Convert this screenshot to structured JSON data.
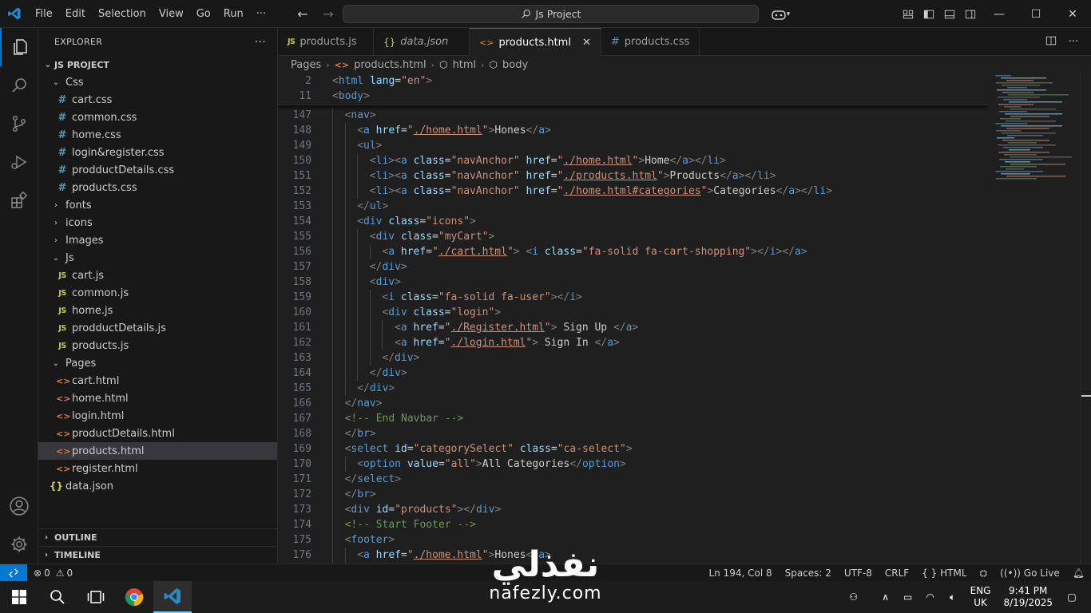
{
  "menu": [
    "File",
    "Edit",
    "Selection",
    "View",
    "Go",
    "Run",
    "···"
  ],
  "command_center": "Js Project",
  "explorer": {
    "title": "EXPLORER",
    "more": "···",
    "project": "JS PROJECT",
    "tree": [
      {
        "label": "Css",
        "kind": "folder-open",
        "depth": 1
      },
      {
        "label": "cart.css",
        "kind": "css",
        "depth": 2
      },
      {
        "label": "common.css",
        "kind": "css",
        "depth": 2
      },
      {
        "label": "home.css",
        "kind": "css",
        "depth": 2
      },
      {
        "label": "login&register.css",
        "kind": "css",
        "depth": 2
      },
      {
        "label": "prodductDetails.css",
        "kind": "css",
        "depth": 2
      },
      {
        "label": "products.css",
        "kind": "css",
        "depth": 2
      },
      {
        "label": "fonts",
        "kind": "folder",
        "depth": 1
      },
      {
        "label": "icons",
        "kind": "folder",
        "depth": 1
      },
      {
        "label": "Images",
        "kind": "folder",
        "depth": 1
      },
      {
        "label": "Js",
        "kind": "folder-open",
        "depth": 1
      },
      {
        "label": "cart.js",
        "kind": "js",
        "depth": 2
      },
      {
        "label": "common.js",
        "kind": "js",
        "depth": 2
      },
      {
        "label": "home.js",
        "kind": "js",
        "depth": 2
      },
      {
        "label": "prodductDetails.js",
        "kind": "js",
        "depth": 2
      },
      {
        "label": "products.js",
        "kind": "js",
        "depth": 2
      },
      {
        "label": "Pages",
        "kind": "folder-open",
        "depth": 1
      },
      {
        "label": "cart.html",
        "kind": "html",
        "depth": 2
      },
      {
        "label": "home.html",
        "kind": "html",
        "depth": 2
      },
      {
        "label": "login.html",
        "kind": "html",
        "depth": 2
      },
      {
        "label": "productDetails.html",
        "kind": "html",
        "depth": 2
      },
      {
        "label": "products.html",
        "kind": "html",
        "depth": 2,
        "selected": true
      },
      {
        "label": "register.html",
        "kind": "html",
        "depth": 2
      },
      {
        "label": "data.json",
        "kind": "json",
        "depth": 1
      }
    ],
    "outline": "OUTLINE",
    "timeline": "TIMELINE"
  },
  "tabs": [
    {
      "label": "products.js",
      "kind": "js"
    },
    {
      "label": "data.json",
      "kind": "json"
    },
    {
      "label": "products.html",
      "kind": "html",
      "active": true
    },
    {
      "label": "products.css",
      "kind": "css"
    }
  ],
  "breadcrumb": [
    "Pages",
    "products.html",
    "html",
    "body"
  ],
  "sticky_lines": [
    {
      "n": "2",
      "indent": 0,
      "tokens": [
        [
          "b",
          "<"
        ],
        [
          "t",
          "html"
        ],
        [
          "x",
          " "
        ],
        [
          "a",
          "lang"
        ],
        [
          "x",
          "="
        ],
        [
          "s",
          "\"en\""
        ],
        [
          "b",
          ">"
        ]
      ]
    },
    {
      "n": "11",
      "indent": 0,
      "tokens": [
        [
          "b",
          "<"
        ],
        [
          "t",
          "body"
        ],
        [
          "b",
          ">"
        ]
      ]
    }
  ],
  "code_lines": [
    {
      "n": "147",
      "indent": 1,
      "tokens": [
        [
          "b",
          "<"
        ],
        [
          "t",
          "nav"
        ],
        [
          "b",
          ">"
        ]
      ]
    },
    {
      "n": "148",
      "indent": 2,
      "tokens": [
        [
          "b",
          "<"
        ],
        [
          "t",
          "a"
        ],
        [
          "x",
          " "
        ],
        [
          "a",
          "href"
        ],
        [
          "x",
          "="
        ],
        [
          "s",
          "\""
        ],
        [
          "u",
          "./home.html"
        ],
        [
          "s",
          "\""
        ],
        [
          "b",
          ">"
        ],
        [
          "x",
          "Hones"
        ],
        [
          "b",
          "</"
        ],
        [
          "t",
          "a"
        ],
        [
          "b",
          ">"
        ]
      ]
    },
    {
      "n": "149",
      "indent": 2,
      "tokens": [
        [
          "b",
          "<"
        ],
        [
          "t",
          "ul"
        ],
        [
          "b",
          ">"
        ]
      ]
    },
    {
      "n": "150",
      "indent": 3,
      "tokens": [
        [
          "b",
          "<"
        ],
        [
          "t",
          "li"
        ],
        [
          "b",
          "><"
        ],
        [
          "t",
          "a"
        ],
        [
          "x",
          " "
        ],
        [
          "a",
          "class"
        ],
        [
          "x",
          "="
        ],
        [
          "s",
          "\"navAnchor\""
        ],
        [
          "x",
          " "
        ],
        [
          "a",
          "href"
        ],
        [
          "x",
          "="
        ],
        [
          "s",
          "\""
        ],
        [
          "u",
          "./home.html"
        ],
        [
          "s",
          "\""
        ],
        [
          "b",
          ">"
        ],
        [
          "x",
          "Home"
        ],
        [
          "b",
          "</"
        ],
        [
          "t",
          "a"
        ],
        [
          "b",
          "></"
        ],
        [
          "t",
          "li"
        ],
        [
          "b",
          ">"
        ]
      ]
    },
    {
      "n": "151",
      "indent": 3,
      "tokens": [
        [
          "b",
          "<"
        ],
        [
          "t",
          "li"
        ],
        [
          "b",
          "><"
        ],
        [
          "t",
          "a"
        ],
        [
          "x",
          " "
        ],
        [
          "a",
          "class"
        ],
        [
          "x",
          "="
        ],
        [
          "s",
          "\"navAnchor\""
        ],
        [
          "x",
          " "
        ],
        [
          "a",
          "href"
        ],
        [
          "x",
          "="
        ],
        [
          "s",
          "\""
        ],
        [
          "u",
          "./products.html"
        ],
        [
          "s",
          "\""
        ],
        [
          "b",
          ">"
        ],
        [
          "x",
          "Products"
        ],
        [
          "b",
          "</"
        ],
        [
          "t",
          "a"
        ],
        [
          "b",
          "></"
        ],
        [
          "t",
          "li"
        ],
        [
          "b",
          ">"
        ]
      ]
    },
    {
      "n": "152",
      "indent": 3,
      "tokens": [
        [
          "b",
          "<"
        ],
        [
          "t",
          "li"
        ],
        [
          "b",
          "><"
        ],
        [
          "t",
          "a"
        ],
        [
          "x",
          " "
        ],
        [
          "a",
          "class"
        ],
        [
          "x",
          "="
        ],
        [
          "s",
          "\"navAnchor\""
        ],
        [
          "x",
          " "
        ],
        [
          "a",
          "href"
        ],
        [
          "x",
          "="
        ],
        [
          "s",
          "\""
        ],
        [
          "u",
          "./home.html#categories"
        ],
        [
          "s",
          "\""
        ],
        [
          "b",
          ">"
        ],
        [
          "x",
          "Categories"
        ],
        [
          "b",
          "</"
        ],
        [
          "t",
          "a"
        ],
        [
          "b",
          "></"
        ],
        [
          "t",
          "li"
        ],
        [
          "b",
          ">"
        ]
      ]
    },
    {
      "n": "153",
      "indent": 2,
      "tokens": [
        [
          "b",
          "</"
        ],
        [
          "t",
          "ul"
        ],
        [
          "b",
          ">"
        ]
      ]
    },
    {
      "n": "154",
      "indent": 2,
      "tokens": [
        [
          "b",
          "<"
        ],
        [
          "t",
          "div"
        ],
        [
          "x",
          " "
        ],
        [
          "a",
          "class"
        ],
        [
          "x",
          "="
        ],
        [
          "s",
          "\"icons\""
        ],
        [
          "b",
          ">"
        ]
      ]
    },
    {
      "n": "155",
      "indent": 3,
      "tokens": [
        [
          "b",
          "<"
        ],
        [
          "t",
          "div"
        ],
        [
          "x",
          " "
        ],
        [
          "a",
          "class"
        ],
        [
          "x",
          "="
        ],
        [
          "s",
          "\"myCart\""
        ],
        [
          "b",
          ">"
        ]
      ]
    },
    {
      "n": "156",
      "indent": 4,
      "tokens": [
        [
          "b",
          "<"
        ],
        [
          "t",
          "a"
        ],
        [
          "x",
          " "
        ],
        [
          "a",
          "href"
        ],
        [
          "x",
          "="
        ],
        [
          "s",
          "\""
        ],
        [
          "u",
          "./cart.html"
        ],
        [
          "s",
          "\""
        ],
        [
          "b",
          ">"
        ],
        [
          "x",
          " "
        ],
        [
          "b",
          "<"
        ],
        [
          "t",
          "i"
        ],
        [
          "x",
          " "
        ],
        [
          "a",
          "class"
        ],
        [
          "x",
          "="
        ],
        [
          "s",
          "\"fa-solid fa-cart-shopping\""
        ],
        [
          "b",
          "></"
        ],
        [
          "t",
          "i"
        ],
        [
          "b",
          "></"
        ],
        [
          "t",
          "a"
        ],
        [
          "b",
          ">"
        ]
      ]
    },
    {
      "n": "157",
      "indent": 3,
      "tokens": [
        [
          "b",
          "</"
        ],
        [
          "t",
          "div"
        ],
        [
          "b",
          ">"
        ]
      ]
    },
    {
      "n": "158",
      "indent": 3,
      "tokens": [
        [
          "b",
          "<"
        ],
        [
          "t",
          "div"
        ],
        [
          "b",
          ">"
        ]
      ]
    },
    {
      "n": "159",
      "indent": 4,
      "tokens": [
        [
          "b",
          "<"
        ],
        [
          "t",
          "i"
        ],
        [
          "x",
          " "
        ],
        [
          "a",
          "class"
        ],
        [
          "x",
          "="
        ],
        [
          "s",
          "\"fa-solid fa-user\""
        ],
        [
          "b",
          "></"
        ],
        [
          "t",
          "i"
        ],
        [
          "b",
          ">"
        ]
      ]
    },
    {
      "n": "160",
      "indent": 4,
      "tokens": [
        [
          "b",
          "<"
        ],
        [
          "t",
          "div"
        ],
        [
          "x",
          " "
        ],
        [
          "a",
          "class"
        ],
        [
          "x",
          "="
        ],
        [
          "s",
          "\"login\""
        ],
        [
          "b",
          ">"
        ]
      ]
    },
    {
      "n": "161",
      "indent": 5,
      "tokens": [
        [
          "b",
          "<"
        ],
        [
          "t",
          "a"
        ],
        [
          "x",
          " "
        ],
        [
          "a",
          "href"
        ],
        [
          "x",
          "="
        ],
        [
          "s",
          "\""
        ],
        [
          "u",
          "./Register.html"
        ],
        [
          "s",
          "\""
        ],
        [
          "b",
          ">"
        ],
        [
          "x",
          " Sign Up "
        ],
        [
          "b",
          "</"
        ],
        [
          "t",
          "a"
        ],
        [
          "b",
          ">"
        ]
      ]
    },
    {
      "n": "162",
      "indent": 5,
      "tokens": [
        [
          "b",
          "<"
        ],
        [
          "t",
          "a"
        ],
        [
          "x",
          " "
        ],
        [
          "a",
          "href"
        ],
        [
          "x",
          "="
        ],
        [
          "s",
          "\""
        ],
        [
          "u",
          "./login.html"
        ],
        [
          "s",
          "\""
        ],
        [
          "b",
          ">"
        ],
        [
          "x",
          " Sign In "
        ],
        [
          "b",
          "</"
        ],
        [
          "t",
          "a"
        ],
        [
          "b",
          ">"
        ]
      ]
    },
    {
      "n": "163",
      "indent": 4,
      "tokens": [
        [
          "b",
          "</"
        ],
        [
          "t",
          "div"
        ],
        [
          "b",
          ">"
        ]
      ]
    },
    {
      "n": "164",
      "indent": 3,
      "tokens": [
        [
          "b",
          "</"
        ],
        [
          "t",
          "div"
        ],
        [
          "b",
          ">"
        ]
      ]
    },
    {
      "n": "165",
      "indent": 2,
      "tokens": [
        [
          "b",
          "</"
        ],
        [
          "t",
          "div"
        ],
        [
          "b",
          ">"
        ]
      ]
    },
    {
      "n": "166",
      "indent": 1,
      "tokens": [
        [
          "b",
          "</"
        ],
        [
          "t",
          "nav"
        ],
        [
          "b",
          ">"
        ]
      ]
    },
    {
      "n": "167",
      "indent": 1,
      "tokens": [
        [
          "c",
          "<!-- End Navbar -->"
        ]
      ]
    },
    {
      "n": "168",
      "indent": 1,
      "tokens": [
        [
          "b",
          "</"
        ],
        [
          "t",
          "br"
        ],
        [
          "b",
          ">"
        ]
      ]
    },
    {
      "n": "169",
      "indent": 1,
      "tokens": [
        [
          "b",
          "<"
        ],
        [
          "t",
          "select"
        ],
        [
          "x",
          " "
        ],
        [
          "a",
          "id"
        ],
        [
          "x",
          "="
        ],
        [
          "s",
          "\"categorySelect\""
        ],
        [
          "x",
          " "
        ],
        [
          "a",
          "class"
        ],
        [
          "x",
          "="
        ],
        [
          "s",
          "\"ca-select\""
        ],
        [
          "b",
          ">"
        ]
      ]
    },
    {
      "n": "170",
      "indent": 2,
      "tokens": [
        [
          "b",
          "<"
        ],
        [
          "t",
          "option"
        ],
        [
          "x",
          " "
        ],
        [
          "a",
          "value"
        ],
        [
          "x",
          "="
        ],
        [
          "s",
          "\"all\""
        ],
        [
          "b",
          ">"
        ],
        [
          "x",
          "All Categories"
        ],
        [
          "b",
          "</"
        ],
        [
          "t",
          "option"
        ],
        [
          "b",
          ">"
        ]
      ]
    },
    {
      "n": "171",
      "indent": 1,
      "tokens": [
        [
          "b",
          "</"
        ],
        [
          "t",
          "select"
        ],
        [
          "b",
          ">"
        ]
      ]
    },
    {
      "n": "172",
      "indent": 1,
      "tokens": [
        [
          "b",
          "</"
        ],
        [
          "t",
          "br"
        ],
        [
          "b",
          ">"
        ]
      ]
    },
    {
      "n": "173",
      "indent": 1,
      "tokens": [
        [
          "b",
          "<"
        ],
        [
          "t",
          "div"
        ],
        [
          "x",
          " "
        ],
        [
          "a",
          "id"
        ],
        [
          "x",
          "="
        ],
        [
          "s",
          "\"products\""
        ],
        [
          "b",
          "></"
        ],
        [
          "t",
          "div"
        ],
        [
          "b",
          ">"
        ]
      ]
    },
    {
      "n": "174",
      "indent": 1,
      "tokens": [
        [
          "c",
          "<!-- Start Footer -->"
        ]
      ]
    },
    {
      "n": "175",
      "indent": 1,
      "tokens": [
        [
          "b",
          "<"
        ],
        [
          "t",
          "footer"
        ],
        [
          "b",
          ">"
        ]
      ]
    },
    {
      "n": "176",
      "indent": 2,
      "tokens": [
        [
          "b",
          "<"
        ],
        [
          "t",
          "a"
        ],
        [
          "x",
          " "
        ],
        [
          "a",
          "href"
        ],
        [
          "x",
          "="
        ],
        [
          "s",
          "\""
        ],
        [
          "u",
          "./home.html"
        ],
        [
          "s",
          "\""
        ],
        [
          "b",
          ">"
        ],
        [
          "x",
          "Hones"
        ],
        [
          "b",
          "</"
        ],
        [
          "t",
          "a"
        ],
        [
          "b",
          ">"
        ]
      ]
    }
  ],
  "status": {
    "errors": "0",
    "warnings": "0",
    "position": "Ln 194, Col 8",
    "spaces": "Spaces: 2",
    "encoding": "UTF-8",
    "eol": "CRLF",
    "language": "HTML",
    "golive": "Go Live"
  },
  "taskbar": {
    "lang_top": "ENG",
    "lang_bottom": "UK",
    "time": "9:41 PM",
    "date": "8/19/2025"
  },
  "watermark": {
    "arabic": "نفذلي",
    "latin": "nafezly.com"
  },
  "colors": {
    "accent": "#0078d4",
    "tag": "#569cd6",
    "attr": "#9cdcfe",
    "string": "#ce9178",
    "comment": "#6a9955"
  }
}
